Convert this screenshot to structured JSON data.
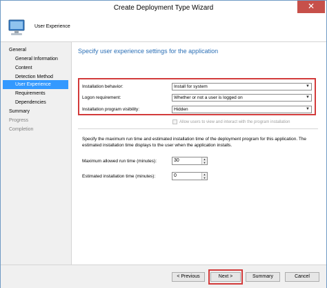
{
  "window": {
    "title": "Create Deployment Type Wizard",
    "close_glyph": "✕"
  },
  "header": {
    "page_name": "User Experience",
    "icon": "computer-monitor-icon"
  },
  "nav": {
    "items": [
      {
        "label": "General",
        "state": "normal"
      },
      {
        "label": "General Information",
        "state": "normal"
      },
      {
        "label": "Content",
        "state": "normal"
      },
      {
        "label": "Detection Method",
        "state": "normal"
      },
      {
        "label": "User Experience",
        "state": "active"
      },
      {
        "label": "Requirements",
        "state": "normal"
      },
      {
        "label": "Dependencies",
        "state": "normal"
      },
      {
        "label": "Summary",
        "state": "normal"
      },
      {
        "label": "Progress",
        "state": "disabled"
      },
      {
        "label": "Completion",
        "state": "disabled"
      }
    ]
  },
  "main": {
    "title": "Specify user experience settings for the application",
    "fields": [
      {
        "label": "Installation behavior:",
        "value": "Install for system"
      },
      {
        "label": "Logon requirement:",
        "value": "Whether or not a user is logged on"
      },
      {
        "label": "Installation program visibility:",
        "value": "Hidden"
      }
    ],
    "allow_interact": {
      "label": "Allow users to view and interact with the program installation",
      "checked": false,
      "enabled": false
    },
    "description": "Specify the maximum run time and estimated installation time of the deployment program for this application. The estimated installation time displays to the user when the application installs.",
    "max_run_time": {
      "label": "Maximum allowed run time (minutes):",
      "value": "30"
    },
    "est_install_time": {
      "label": "Estimated installation time (minutes):",
      "value": "0"
    }
  },
  "footer": {
    "previous_label": "< Previous",
    "next_label": "Next >",
    "summary_label": "Summary",
    "cancel_label": "Cancel"
  },
  "colors": {
    "accent": "#3399ff",
    "title_blue": "#2b6fb6",
    "highlight_red": "#d23a3a"
  }
}
